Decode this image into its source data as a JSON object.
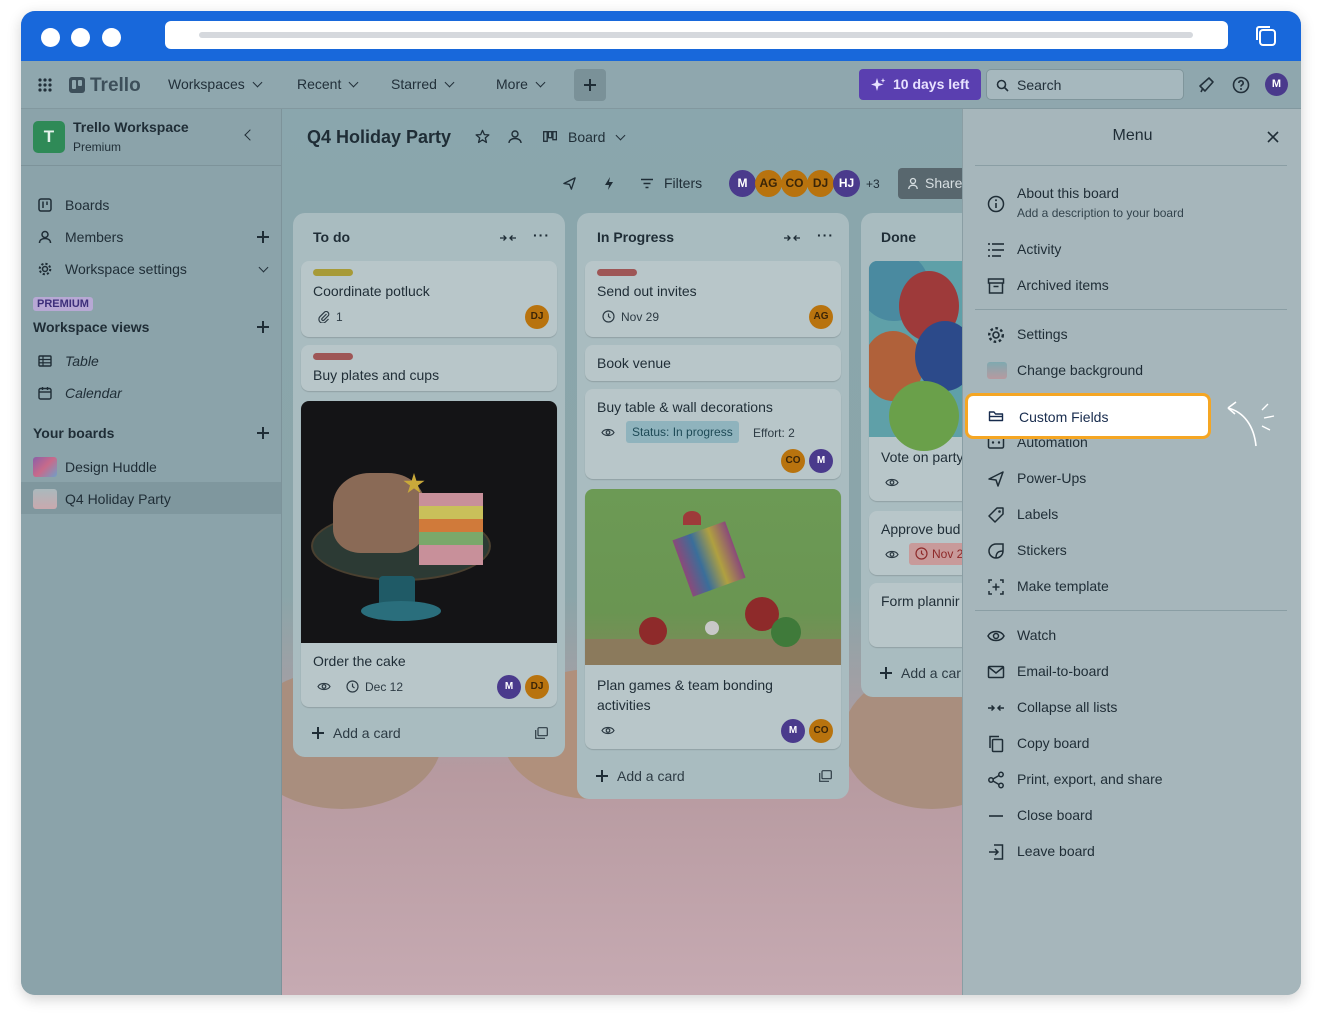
{
  "topnav": {
    "brand": "Trello",
    "items": [
      "Workspaces",
      "Recent",
      "Starred",
      "More"
    ],
    "trial": "10 days left",
    "search_placeholder": "Search",
    "user_initial": "M"
  },
  "sidebar": {
    "workspace_initial": "T",
    "workspace_name": "Trello Workspace",
    "workspace_plan": "Premium",
    "nav": [
      "Boards",
      "Members",
      "Workspace settings"
    ],
    "premium_badge": "PREMIUM",
    "views_title": "Workspace views",
    "views": [
      "Table",
      "Calendar"
    ],
    "boards_title": "Your boards",
    "boards": [
      "Design Huddle",
      "Q4 Holiday Party"
    ]
  },
  "board": {
    "title": "Q4 Holiday Party",
    "view": "Board",
    "filters": "Filters",
    "members": [
      "M",
      "AG",
      "CO",
      "DJ",
      "HJ"
    ],
    "member_overflow": "+3",
    "share": "Share",
    "lists": [
      {
        "title": "To do",
        "cards": [
          {
            "title": "Coordinate potluck",
            "attachments": "1",
            "members": [
              "DJ"
            ]
          },
          {
            "title": "Buy plates and cups"
          },
          {
            "title": "Order the cake",
            "due": "Dec 12",
            "members": [
              "M",
              "DJ"
            ]
          }
        ],
        "add": "Add a card"
      },
      {
        "title": "In Progress",
        "cards": [
          {
            "title": "Send out invites",
            "due": "Nov 29",
            "members": [
              "AG"
            ]
          },
          {
            "title": "Book venue"
          },
          {
            "title": "Buy table & wall decorations",
            "status": "Status: In progress",
            "effort": "Effort: 2",
            "members": [
              "CO",
              "M"
            ]
          },
          {
            "title": "Plan games & team bonding activities",
            "members": [
              "M",
              "CO"
            ]
          }
        ],
        "add": "Add a card"
      },
      {
        "title": "Done",
        "cards": [
          {
            "title": "Vote on party"
          },
          {
            "title": "Approve bud",
            "due": "Nov 2"
          },
          {
            "title": "Form plannir"
          }
        ],
        "add": "Add a car"
      }
    ]
  },
  "menu": {
    "title": "Menu",
    "about_title": "About this board",
    "about_sub": "Add a description to your board",
    "group1": [
      "Activity",
      "Archived items"
    ],
    "group2": [
      "Settings",
      "Change background",
      "Custom Fields",
      "Automation",
      "Power-Ups",
      "Labels",
      "Stickers",
      "Make template"
    ],
    "group3": [
      "Watch",
      "Email-to-board",
      "Collapse all lists",
      "Copy board",
      "Print, export, and share",
      "Close board",
      "Leave board"
    ]
  },
  "colors": {
    "browser": "#1868db",
    "highlight": "#f5a623",
    "trial": "#5a3fb0"
  }
}
